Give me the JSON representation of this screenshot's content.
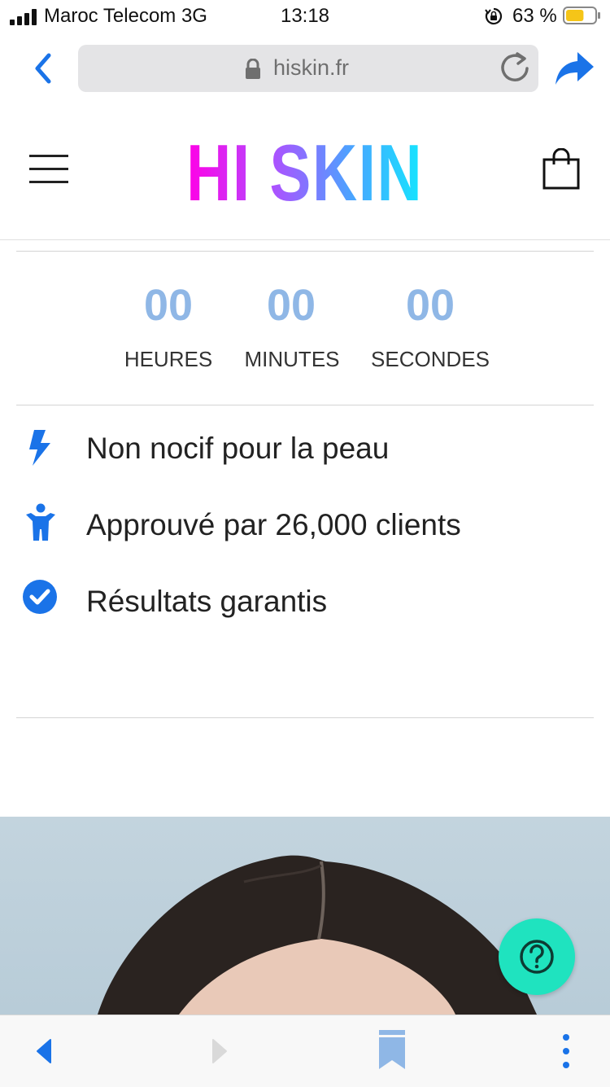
{
  "status_bar": {
    "carrier": "Maroc Telecom",
    "network": "3G",
    "time": "13:18",
    "battery_percent": "63 %",
    "battery_level": 0.63,
    "icons": [
      "signal-icon",
      "orientation-lock-icon",
      "battery-icon"
    ]
  },
  "browser": {
    "url": "hiskin.fr",
    "icons": [
      "back-chevron-icon",
      "lock-icon",
      "reload-icon",
      "share-icon"
    ]
  },
  "site": {
    "logo": "HI SKIN",
    "icons": [
      "menu-icon",
      "shopping-bag-icon"
    ]
  },
  "countdown": [
    {
      "value": "00",
      "label": "HEURES"
    },
    {
      "value": "00",
      "label": "MINUTES"
    },
    {
      "value": "00",
      "label": "SECONDES"
    }
  ],
  "features": [
    {
      "icon": "lightning-icon",
      "text": "Non nocif pour la peau"
    },
    {
      "icon": "person-icon",
      "text": "Approuvé par 26,000 clients"
    },
    {
      "icon": "check-circle-icon",
      "text": "Résultats garantis"
    }
  ],
  "help_button": {
    "icon": "help-icon"
  },
  "toolbar": {
    "icons": [
      "back-arrow-icon",
      "forward-arrow-icon",
      "bookmark-icon",
      "more-icon"
    ]
  },
  "colors": {
    "accent_blue": "#1a73e8",
    "countdown_blue": "#8fb7e6",
    "help_teal": "#1fe3bf",
    "logo_gradient": [
      "#ff00e6",
      "#b24dff",
      "#4aa4ff",
      "#14e6ff"
    ]
  }
}
